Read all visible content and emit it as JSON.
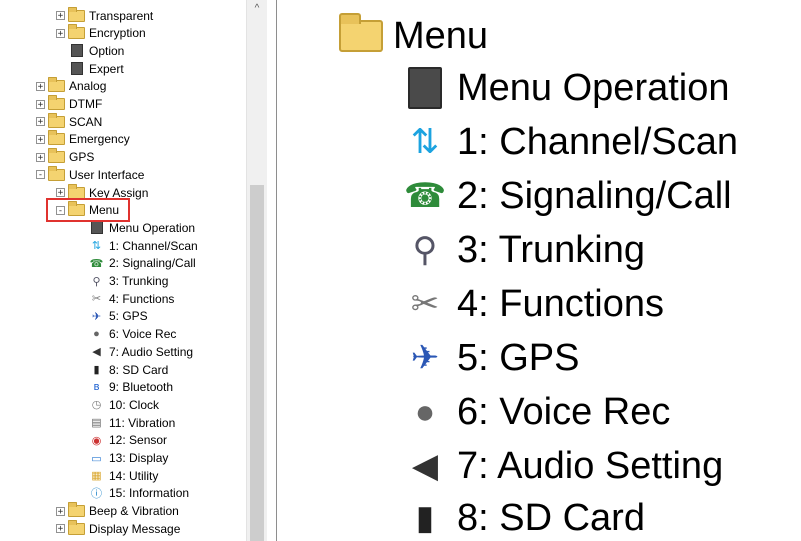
{
  "tree": {
    "rows": [
      {
        "label": "Transparent",
        "expander": "+",
        "icon": "folder-icon"
      },
      {
        "label": "Encryption",
        "expander": "+",
        "icon": "folder-icon"
      },
      {
        "label": "Option",
        "expander": "",
        "icon": "book-icon"
      },
      {
        "label": "Expert",
        "expander": "",
        "icon": "book-icon"
      },
      {
        "label": "Analog",
        "expander": "+",
        "icon": "folder-icon"
      },
      {
        "label": "DTMF",
        "expander": "+",
        "icon": "folder-icon"
      },
      {
        "label": "SCAN",
        "expander": "+",
        "icon": "folder-icon"
      },
      {
        "label": "Emergency",
        "expander": "+",
        "icon": "folder-icon"
      },
      {
        "label": "GPS",
        "expander": "+",
        "icon": "folder-icon"
      },
      {
        "label": "User Interface",
        "expander": "-",
        "icon": "folder-icon"
      },
      {
        "label": "Key Assign",
        "expander": "+",
        "icon": "folder-icon"
      },
      {
        "label": "Menu",
        "expander": "-",
        "icon": "folder-icon"
      },
      {
        "label": "Menu Operation",
        "expander": "",
        "icon": "book-icon"
      },
      {
        "label": "1: Channel/Scan",
        "expander": "",
        "icon": "arrows-icon"
      },
      {
        "label": "2: Signaling/Call",
        "expander": "",
        "icon": "phone-icon"
      },
      {
        "label": "3: Trunking",
        "expander": "",
        "icon": "antenna-icon"
      },
      {
        "label": "4: Functions",
        "expander": "",
        "icon": "tools-icon"
      },
      {
        "label": "5: GPS",
        "expander": "",
        "icon": "satellite-icon"
      },
      {
        "label": "6: Voice Rec",
        "expander": "",
        "icon": "microphone-icon"
      },
      {
        "label": "7: Audio Setting",
        "expander": "",
        "icon": "speaker-icon"
      },
      {
        "label": "8: SD Card",
        "expander": "",
        "icon": "sd-card-icon"
      },
      {
        "label": "9: Bluetooth",
        "expander": "",
        "icon": "bluetooth-icon"
      },
      {
        "label": "10: Clock",
        "expander": "",
        "icon": "clock-icon"
      },
      {
        "label": "11: Vibration",
        "expander": "",
        "icon": "vibration-icon"
      },
      {
        "label": "12: Sensor",
        "expander": "",
        "icon": "sensor-icon"
      },
      {
        "label": "13: Display",
        "expander": "",
        "icon": "display-icon"
      },
      {
        "label": "14: Utility",
        "expander": "",
        "icon": "utility-icon"
      },
      {
        "label": "15: Information",
        "expander": "",
        "icon": "info-icon"
      },
      {
        "label": "Beep & Vibration",
        "expander": "+",
        "icon": "folder-icon"
      },
      {
        "label": "Display Message",
        "expander": "+",
        "icon": "folder-icon"
      }
    ],
    "selected": "Menu"
  },
  "scrollbar": {
    "up_arrow": "^"
  },
  "zoom": {
    "rows": [
      {
        "label": "Menu",
        "icon": "folder-icon"
      },
      {
        "label": "Menu Operation",
        "icon": "book-icon"
      },
      {
        "label": "1: Channel/Scan",
        "icon": "arrows-icon"
      },
      {
        "label": "2: Signaling/Call",
        "icon": "phone-icon"
      },
      {
        "label": "3: Trunking",
        "icon": "antenna-icon"
      },
      {
        "label": "4: Functions",
        "icon": "tools-icon"
      },
      {
        "label": "5: GPS",
        "icon": "satellite-icon"
      },
      {
        "label": "6: Voice Rec",
        "icon": "microphone-icon"
      },
      {
        "label": "7: Audio Setting",
        "icon": "speaker-icon"
      },
      {
        "label": "8: SD Card",
        "icon": "sd-card-icon"
      }
    ]
  },
  "colors": {
    "highlight": "#e0322f",
    "folder": "#f4d370"
  }
}
